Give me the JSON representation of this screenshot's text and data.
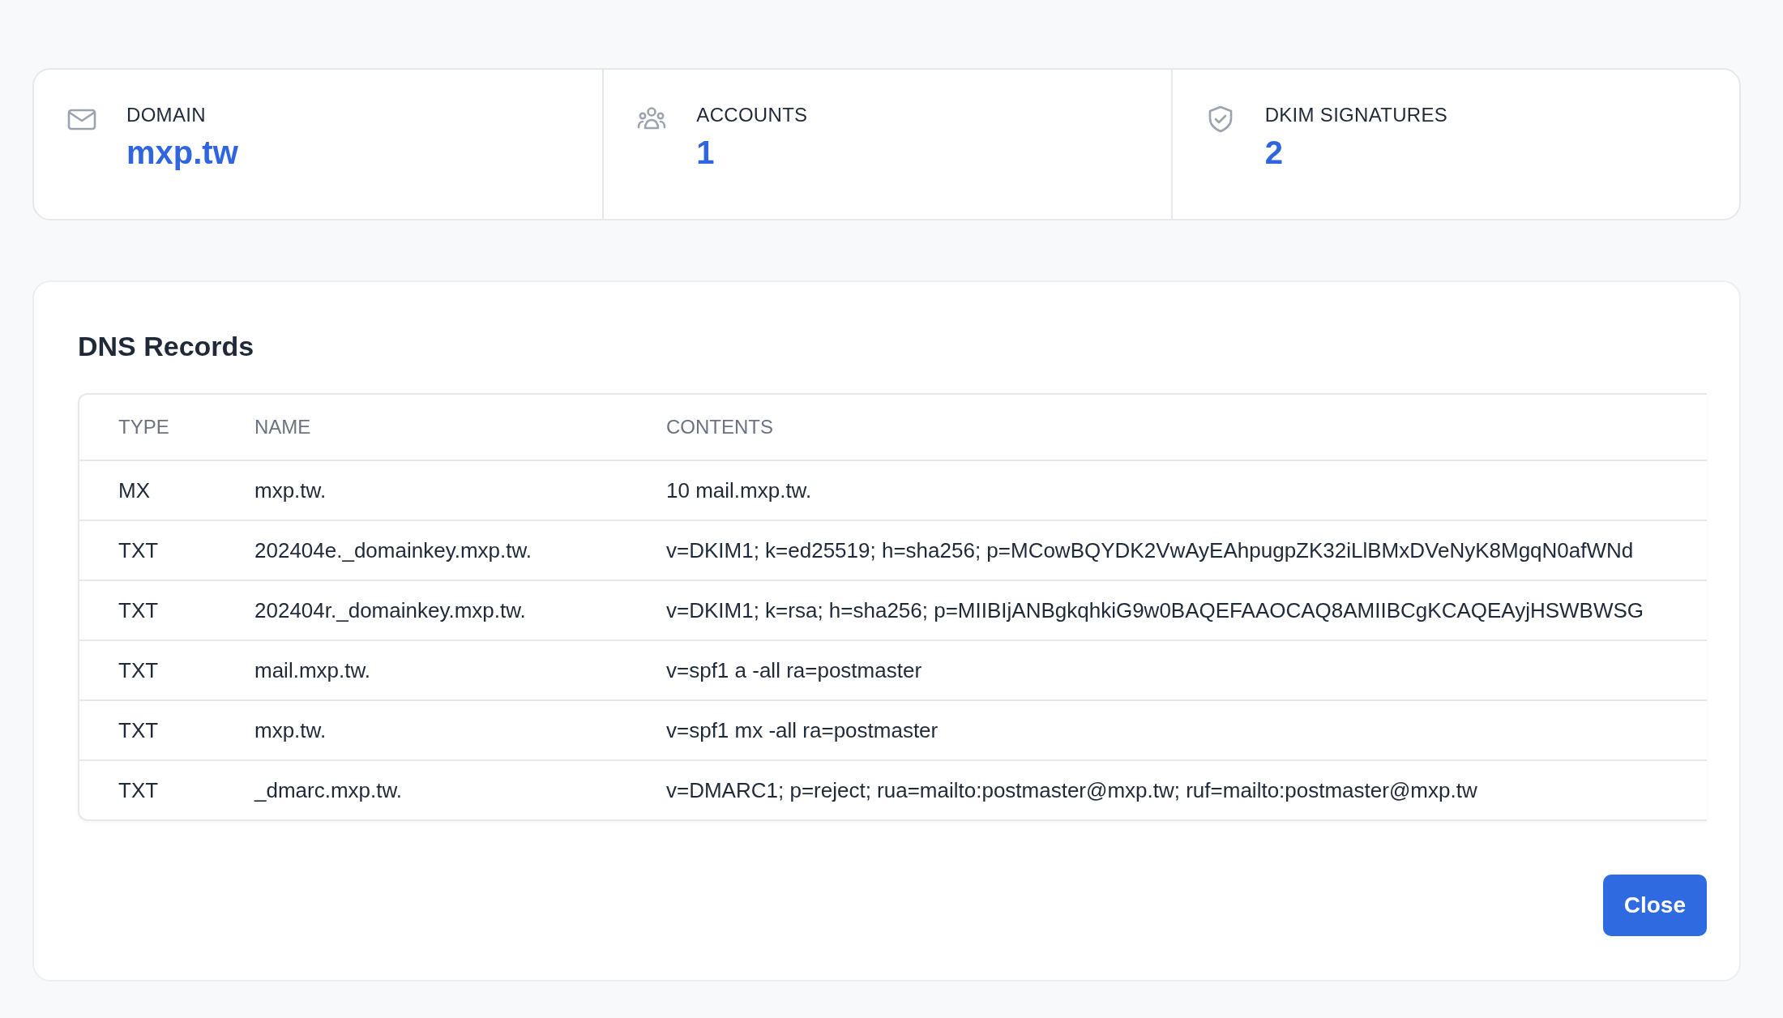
{
  "stats": [
    {
      "kind": "mail",
      "label": "DOMAIN",
      "value": "mxp.tw"
    },
    {
      "kind": "people",
      "label": "ACCOUNTS",
      "value": "1"
    },
    {
      "kind": "shield",
      "label": "DKIM SIGNATURES",
      "value": "2"
    }
  ],
  "dns": {
    "title": "DNS Records",
    "columns": [
      "TYPE",
      "NAME",
      "CONTENTS"
    ],
    "rows": [
      [
        "MX",
        "mxp.tw.",
        "10 mail.mxp.tw."
      ],
      [
        "TXT",
        "202404e._domainkey.mxp.tw.",
        "v=DKIM1; k=ed25519; h=sha256; p=MCowBQYDK2VwAyEAhpugpZK32iLlBMxDVeNyK8MgqN0afWNd"
      ],
      [
        "TXT",
        "202404r._domainkey.mxp.tw.",
        "v=DKIM1; k=rsa; h=sha256; p=MIIBIjANBgkqhkiG9w0BAQEFAAOCAQ8AMIIBCgKCAQEAyjHSWBWSG"
      ],
      [
        "TXT",
        "mail.mxp.tw.",
        "v=spf1 a -all ra=postmaster"
      ],
      [
        "TXT",
        "mxp.tw.",
        "v=spf1 mx -all ra=postmaster"
      ],
      [
        "TXT",
        "_dmarc.mxp.tw.",
        "v=DMARC1; p=reject; rua=mailto:postmaster@mxp.tw; ruf=mailto:postmaster@mxp.tw"
      ]
    ]
  },
  "button": "Close"
}
